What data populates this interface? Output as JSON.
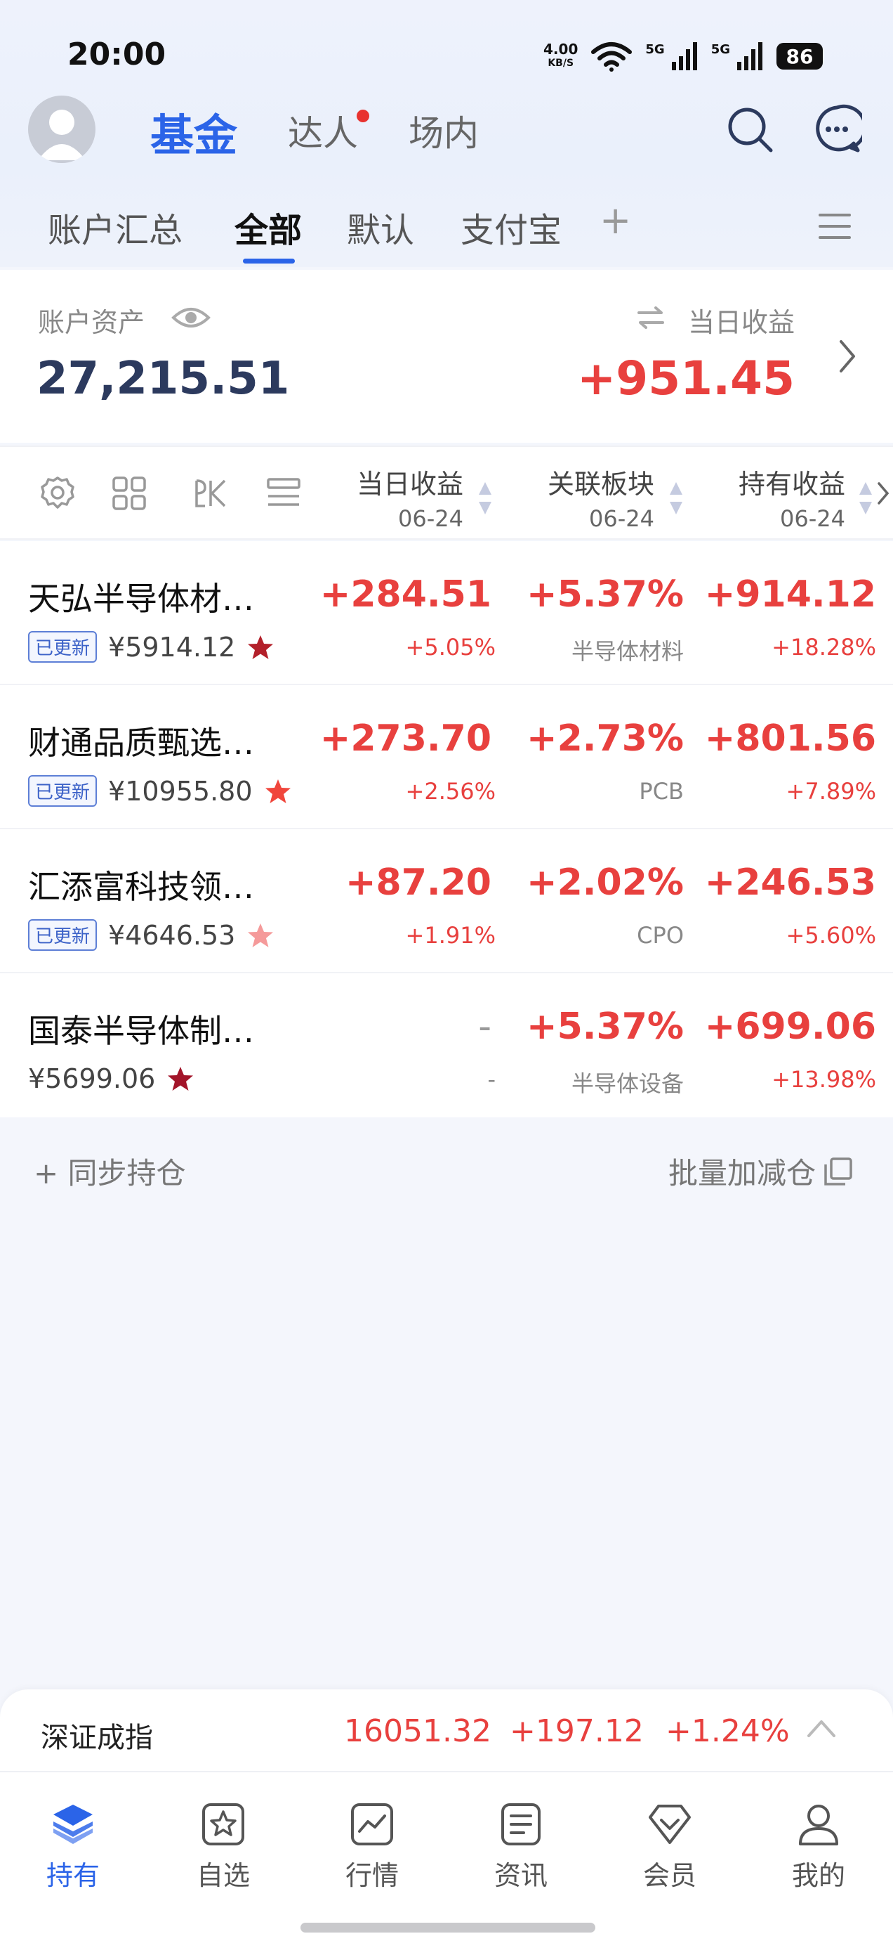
{
  "status": {
    "time": "20:00",
    "net_speed_value": "4.00",
    "net_speed_unit": "KB/S",
    "sim1": "5G",
    "sim2": "5G",
    "battery": "86"
  },
  "header": {
    "tabs": [
      {
        "label": "基金",
        "active": true
      },
      {
        "label": "达人",
        "active": false,
        "dot": true
      },
      {
        "label": "场内",
        "active": false
      }
    ]
  },
  "sub_tabs": [
    {
      "label": "账户汇总",
      "active": false
    },
    {
      "label": "全部",
      "active": true
    },
    {
      "label": "默认",
      "active": false
    },
    {
      "label": "支付宝",
      "active": false
    },
    {
      "label": "+",
      "active": false
    }
  ],
  "asset": {
    "label": "账户资产",
    "value": "27,215.51",
    "daily_label": "当日收益",
    "daily_value": "+951.45"
  },
  "table": {
    "columns": [
      {
        "title": "当日收益",
        "date": "06-24"
      },
      {
        "title": "关联板块",
        "date": "06-24"
      },
      {
        "title": "持有收益",
        "date": "06-24"
      }
    ],
    "rows": [
      {
        "name": "天弘半导体材…",
        "badge": "已更新",
        "nav": "¥5914.12",
        "star_color": "#b3202a",
        "daily": "+284.51",
        "daily_pct": "+5.05%",
        "sector_pct": "+5.37%",
        "sector": "半导体材料",
        "hold": "+914.12",
        "hold_pct": "+18.28%"
      },
      {
        "name": "财通品质甄选…",
        "badge": "已更新",
        "nav": "¥10955.80",
        "star_color": "#f0463c",
        "daily": "+273.70",
        "daily_pct": "+2.56%",
        "sector_pct": "+2.73%",
        "sector": "PCB",
        "hold": "+801.56",
        "hold_pct": "+7.89%"
      },
      {
        "name": "汇添富科技领…",
        "badge": "已更新",
        "nav": "¥4646.53",
        "star_color": "#f59a9a",
        "daily": "+87.20",
        "daily_pct": "+1.91%",
        "sector_pct": "+2.02%",
        "sector": "CPO",
        "hold": "+246.53",
        "hold_pct": "+5.60%"
      },
      {
        "name": "国泰半导体制…",
        "badge": "",
        "nav": "¥5699.06",
        "star_color": "#a3152a",
        "daily": "-",
        "daily_pct": "-",
        "sector_pct": "+5.37%",
        "sector": "半导体设备",
        "hold": "+699.06",
        "hold_pct": "+13.98%"
      }
    ]
  },
  "actions": {
    "sync": "+ 同步持仓",
    "batch": "批量加减仓"
  },
  "index_bar": {
    "name": "深证成指",
    "value": "16051.32",
    "change": "+197.12",
    "pct": "+1.24%"
  },
  "bottom_nav": [
    {
      "label": "持有",
      "icon": "layers-icon",
      "active": true
    },
    {
      "label": "自选",
      "icon": "star-box-icon",
      "active": false
    },
    {
      "label": "行情",
      "icon": "chart-icon",
      "active": false
    },
    {
      "label": "资讯",
      "icon": "news-icon",
      "active": false
    },
    {
      "label": "会员",
      "icon": "diamond-icon",
      "active": false
    },
    {
      "label": "我的",
      "icon": "person-icon",
      "active": false
    }
  ],
  "colors": {
    "accent": "#2b64e8",
    "up": "#e8403e"
  }
}
